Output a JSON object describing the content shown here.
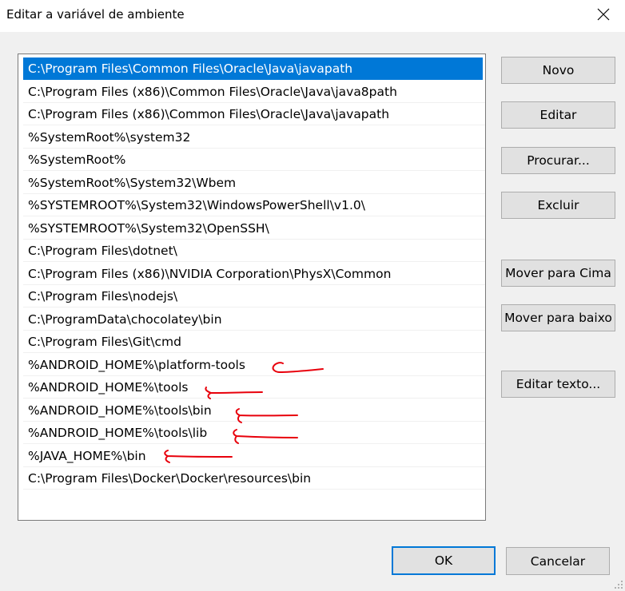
{
  "window": {
    "title": "Editar a variável de ambiente"
  },
  "paths": [
    "C:\\Program Files\\Common Files\\Oracle\\Java\\javapath",
    "C:\\Program Files (x86)\\Common Files\\Oracle\\Java\\java8path",
    "C:\\Program Files (x86)\\Common Files\\Oracle\\Java\\javapath",
    "%SystemRoot%\\system32",
    "%SystemRoot%",
    "%SystemRoot%\\System32\\Wbem",
    "%SYSTEMROOT%\\System32\\WindowsPowerShell\\v1.0\\",
    "%SYSTEMROOT%\\System32\\OpenSSH\\",
    "C:\\Program Files\\dotnet\\",
    "C:\\Program Files (x86)\\NVIDIA Corporation\\PhysX\\Common",
    "C:\\Program Files\\nodejs\\",
    "C:\\ProgramData\\chocolatey\\bin",
    "C:\\Program Files\\Git\\cmd",
    "%ANDROID_HOME%\\platform-tools",
    "%ANDROID_HOME%\\tools",
    "%ANDROID_HOME%\\tools\\bin",
    "%ANDROID_HOME%\\tools\\lib",
    "%JAVA_HOME%\\bin",
    "C:\\Program Files\\Docker\\Docker\\resources\\bin"
  ],
  "buttons": {
    "novo": "Novo",
    "editar": "Editar",
    "procurar": "Procurar...",
    "excluir": "Excluir",
    "mover_cima": "Mover para Cima",
    "mover_baixo": "Mover para baixo",
    "editar_texto": "Editar texto...",
    "ok": "OK",
    "cancelar": "Cancelar"
  },
  "colors": {
    "selection": "#0078d7",
    "annotation": "#e8000b"
  },
  "icons": {
    "close": "close-icon",
    "resize": "resize-grip-icon"
  }
}
